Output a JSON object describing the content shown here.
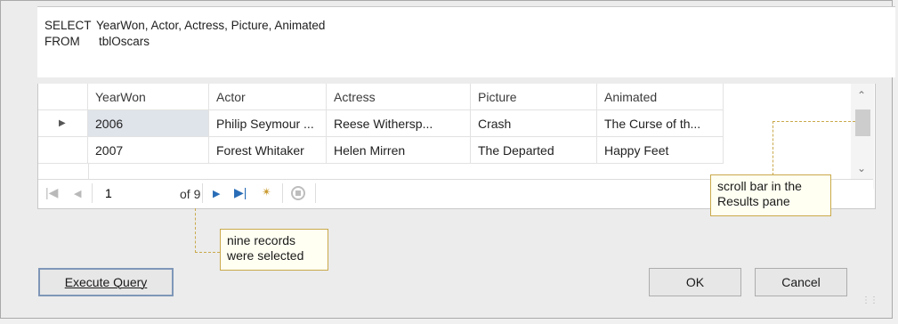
{
  "sql": {
    "select_keyword": "SELECT",
    "select_fields": "YearWon, Actor, Actress, Picture, Animated",
    "from_keyword": "FROM",
    "from_table": "tblOscars"
  },
  "results": {
    "columns": [
      "YearWon",
      "Actor",
      "Actress",
      "Picture",
      "Animated"
    ],
    "rows": [
      [
        "2006",
        "Philip Seymour ...",
        "Reese Withersp...",
        "Crash",
        "The Curse of th..."
      ],
      [
        "2007",
        "Forest Whitaker",
        "Helen Mirren",
        "The Departed",
        "Happy Feet"
      ]
    ]
  },
  "navigator": {
    "current_record": "1",
    "of_total": "of 9"
  },
  "callouts": {
    "scroll": "scroll bar in the Results pane",
    "records": "nine records were selected"
  },
  "buttons": {
    "execute": "Execute Query",
    "ok": "OK",
    "cancel": "Cancel"
  },
  "icons": {
    "first": "first-record-icon",
    "prev": "previous-record-icon",
    "next": "next-record-icon",
    "last": "last-record-icon",
    "new": "new-record-icon",
    "stop": "stop-icon"
  }
}
